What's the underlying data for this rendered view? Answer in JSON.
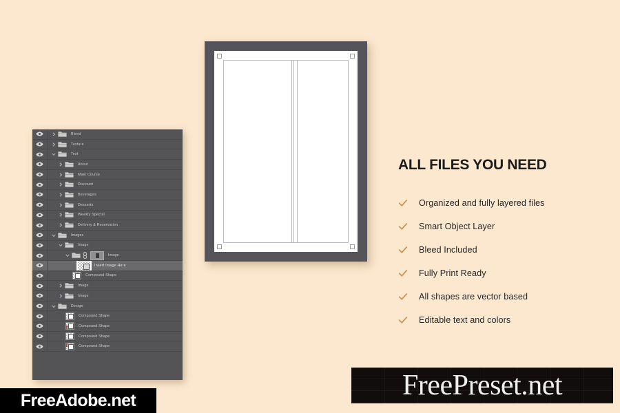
{
  "background_color": "#fce8cf",
  "layers_panel": {
    "panel_background": "#545355",
    "selected_row_background": "#6a696b",
    "rows": [
      {
        "name": "Bleed",
        "indent": 0,
        "twisty": "collapsed",
        "icon": "folder-icon",
        "visible": true,
        "selected": false
      },
      {
        "name": "Texture",
        "indent": 0,
        "twisty": "collapsed",
        "icon": "folder-icon",
        "visible": true,
        "selected": false
      },
      {
        "name": "Text",
        "indent": 0,
        "twisty": "expanded",
        "icon": "folder-icon",
        "visible": true,
        "selected": false
      },
      {
        "name": "About",
        "indent": 1,
        "twisty": "collapsed",
        "icon": "folder-icon",
        "visible": true,
        "selected": false
      },
      {
        "name": "Main Course",
        "indent": 1,
        "twisty": "collapsed",
        "icon": "folder-icon",
        "visible": true,
        "selected": false
      },
      {
        "name": "Discount",
        "indent": 1,
        "twisty": "collapsed",
        "icon": "folder-icon",
        "visible": true,
        "selected": false
      },
      {
        "name": "Beverages",
        "indent": 1,
        "twisty": "collapsed",
        "icon": "folder-icon",
        "visible": true,
        "selected": false
      },
      {
        "name": "Desserts",
        "indent": 1,
        "twisty": "collapsed",
        "icon": "folder-icon",
        "visible": true,
        "selected": false
      },
      {
        "name": "Weekly Special",
        "indent": 1,
        "twisty": "collapsed",
        "icon": "folder-icon",
        "visible": true,
        "selected": false
      },
      {
        "name": "Delivery & Reservation",
        "indent": 1,
        "twisty": "collapsed",
        "icon": "folder-icon",
        "visible": true,
        "selected": false
      },
      {
        "name": "Images",
        "indent": 0,
        "twisty": "expanded",
        "icon": "folder-icon",
        "visible": true,
        "selected": false
      },
      {
        "name": "Image",
        "indent": 1,
        "twisty": "expanded",
        "icon": "folder-icon",
        "visible": true,
        "selected": false
      },
      {
        "name": "Image",
        "indent": 2,
        "twisty": "expanded",
        "icon": "folder-link-mask",
        "visible": true,
        "selected": false
      },
      {
        "name": "Insert Image Here",
        "indent": 3,
        "twisty": "none",
        "icon": "smart-object-thumbnail",
        "visible": true,
        "selected": true
      },
      {
        "name": "Compound Shape",
        "indent": 2,
        "twisty": "none",
        "icon": "shape-thumbnail",
        "visible": true,
        "selected": false
      },
      {
        "name": "Image",
        "indent": 1,
        "twisty": "collapsed",
        "icon": "folder-icon",
        "visible": true,
        "selected": false
      },
      {
        "name": "Image",
        "indent": 1,
        "twisty": "collapsed",
        "icon": "folder-icon",
        "visible": true,
        "selected": false
      },
      {
        "name": "Design",
        "indent": 0,
        "twisty": "expanded",
        "icon": "folder-icon",
        "visible": true,
        "selected": false
      },
      {
        "name": "Compound Shape",
        "indent": 1,
        "twisty": "none",
        "icon": "shape-thumbnail",
        "visible": true,
        "selected": false
      },
      {
        "name": "Compound Shape",
        "indent": 1,
        "twisty": "none",
        "icon": "shape-thumbnail-red",
        "visible": true,
        "selected": false
      },
      {
        "name": "Compound Shape",
        "indent": 1,
        "twisty": "none",
        "icon": "shape-thumbnail",
        "visible": true,
        "selected": false
      },
      {
        "name": "Compound Shape",
        "indent": 1,
        "twisty": "none",
        "icon": "shape-thumbnail-red-tl",
        "visible": true,
        "selected": false
      }
    ]
  },
  "mockup": {
    "name": "document-canvas-preview",
    "canvas_color": "#54545a",
    "page_color": "#ffffff",
    "guide_color": "#b9b9bd",
    "crop_marks": 4
  },
  "features": {
    "title": "ALL FILES YOU NEED",
    "check_color": "#c89050",
    "items": [
      {
        "label": "Organized and fully layered files"
      },
      {
        "label": "Smart Object Layer"
      },
      {
        "label": "Bleed Included"
      },
      {
        "label": "Fully Print Ready"
      },
      {
        "label": "All shapes are vector based"
      },
      {
        "label": "Editable text and colors"
      }
    ]
  },
  "watermarks": {
    "left": "FreeAdobe.net",
    "right": "FreePreset.net"
  }
}
